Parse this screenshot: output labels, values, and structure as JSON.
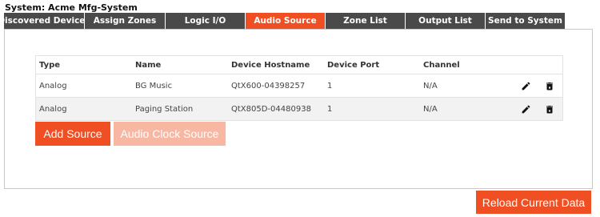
{
  "system": {
    "title": "System: Acme Mfg-System"
  },
  "tabs": [
    {
      "label": "Discovered Devices",
      "active": false
    },
    {
      "label": "Assign Zones",
      "active": false
    },
    {
      "label": "Logic I/O",
      "active": false
    },
    {
      "label": "Audio Source",
      "active": true
    },
    {
      "label": "Zone List",
      "active": false
    },
    {
      "label": "Output List",
      "active": false
    },
    {
      "label": "Send to System",
      "active": false
    }
  ],
  "table": {
    "headers": {
      "type": "Type",
      "name": "Name",
      "hostname": "Device Hostname",
      "port": "Device Port",
      "channel": "Channel"
    },
    "rows": [
      {
        "type": "Analog",
        "name": "BG Music",
        "hostname": "QtX600-04398257",
        "port": "1",
        "channel": "N/A"
      },
      {
        "type": "Analog",
        "name": "Paging Station",
        "hostname": "QtX805D-04480938",
        "port": "1",
        "channel": "N/A"
      }
    ]
  },
  "icons": {
    "edit": "pencil-icon",
    "delete": "trash-icon"
  },
  "buttons": {
    "add_source": "Add Source",
    "audio_clock_source": "Audio Clock Source",
    "reload": "Reload Current Data"
  },
  "colors": {
    "accent": "#f04e23",
    "accent_disabled": "#f7b7a3",
    "tab_inactive": "#4a4a4a"
  }
}
